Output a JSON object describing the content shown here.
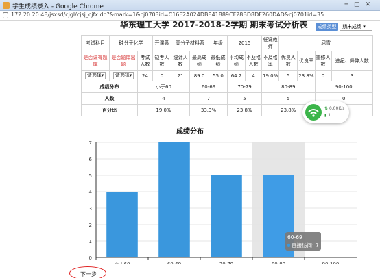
{
  "window": {
    "title": "学生成绩录入 - Google Chrome",
    "url": "172.20.20.48/jsxsd/cjgl/cjsj_cjfx.do?&mark=1&cj0703id=C16F2A024DB841889CF28BD8DF260DAD&cj0701id=35"
  },
  "page": {
    "title": "华东理工大学 2017-2018-2学期 期末考试分析表",
    "tag_button": "成绩类型",
    "score_type_select": "期末成绩"
  },
  "info_table": {
    "row1": {
      "exam_subject_label": "考试科目",
      "exam_subject_value": "硅分子化学",
      "course_code_label": "开课系",
      "course_code_value": "高分子材料系",
      "year_label": "年级",
      "year_value": "2015",
      "teacher_label": "任课教师",
      "teacher_value": "屈雪"
    },
    "row2": {
      "h1": "是否课有题库",
      "h2": "是否题库出题",
      "h3": "考试人数",
      "h4": "缺考人数",
      "h5": "统计人数",
      "h6": "最高成绩",
      "h7": "最低成绩",
      "h8": "平均成绩",
      "h9": "不及格人数",
      "h10": "不及格率",
      "h11": "优良人数",
      "h12": "优良率",
      "h13": "重修人数",
      "h14": "违纪、舞弊人数"
    },
    "row3": {
      "sel1": "请选择",
      "sel2": "请选择",
      "v3": "24",
      "v4": "0",
      "v5": "21",
      "v6": "89.0",
      "v7": "55.0",
      "v8": "64.2",
      "v9": "4",
      "v10": "19.0%",
      "v11": "5",
      "v12": "23.8%",
      "v13": "0",
      "v14": "3"
    },
    "dist": {
      "label": "成绩分布",
      "ranges": [
        "小于60",
        "60-69",
        "70-79",
        "80-89",
        "90-100"
      ],
      "count_label": "人数",
      "counts": [
        "4",
        "7",
        "5",
        "5",
        "0"
      ],
      "pct_label": "百分比",
      "pcts": [
        "19.0%",
        "33.3%",
        "23.8%",
        "23.8%",
        ""
      ]
    }
  },
  "network_widget": {
    "speed": "0.00K/s",
    "count": "1"
  },
  "chart_data": {
    "type": "bar",
    "title": "成绩分布",
    "categories": [
      "小于60",
      "60-69",
      "70-79",
      "80-89",
      "90-100"
    ],
    "values": [
      4,
      7,
      5,
      5,
      0
    ],
    "ylim": [
      0,
      7
    ],
    "yticks": [
      0,
      1,
      2,
      3,
      4,
      5,
      6,
      7
    ],
    "grid": true,
    "colors": {
      "bar": "#3a97dd",
      "bar_hover": "#3f9ce6",
      "hover_band": "#e6e6e6",
      "grid": "#e4e4e4",
      "tooltip_bg": "#7a7a7a"
    },
    "tooltip": {
      "title": "60-69",
      "label": "直接访问: 7",
      "category_index": 1
    },
    "highlight_index": 3
  },
  "footer": {
    "next_button": "下一步"
  }
}
